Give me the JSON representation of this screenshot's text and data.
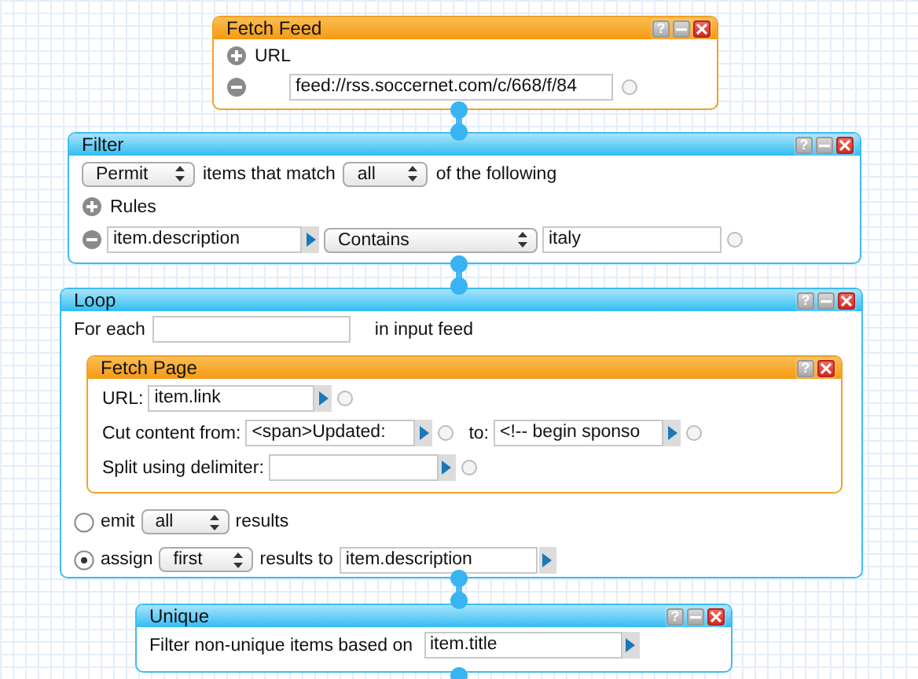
{
  "modules": [
    {
      "kind": "fetch_feed",
      "title": "Fetch Feed",
      "help": "?",
      "minimizable": true,
      "add_label": "URL",
      "url": "feed://rss.soccernet.com/c/668/f/84"
    },
    {
      "kind": "filter",
      "title": "Filter",
      "help": "?",
      "minimizable": true,
      "mode": "Permit",
      "match_label": "items that match",
      "match": "all",
      "match_suffix": "of the following",
      "add_label": "Rules",
      "rule": {
        "field": "item.description",
        "operator": "Contains",
        "value": "italy"
      }
    },
    {
      "kind": "loop",
      "title": "Loop",
      "help": "?",
      "minimizable": true,
      "for_each_label": "For each",
      "for_each_suffix": "in input feed",
      "inner": {
        "title": "Fetch Page",
        "help": "?",
        "minimizable": false,
        "url_label": "URL:",
        "url": "item.link",
        "cut_label": "Cut content from:",
        "cut_from": "<span>Updated:",
        "to_label": "to:",
        "cut_to": "<!-- begin sponso",
        "split_label": "Split using delimiter:"
      },
      "outputs": [
        {
          "kind": "emit",
          "label": "emit",
          "selected": false,
          "option": "all",
          "suffix": "results"
        },
        {
          "kind": "assign",
          "label": "assign",
          "selected": true,
          "option": "first",
          "suffix": "results to",
          "target": "item.description"
        }
      ]
    },
    {
      "kind": "unique",
      "title": "Unique",
      "help": "?",
      "minimizable": true,
      "label": "Filter non-unique items based on",
      "field": "item.title"
    }
  ]
}
